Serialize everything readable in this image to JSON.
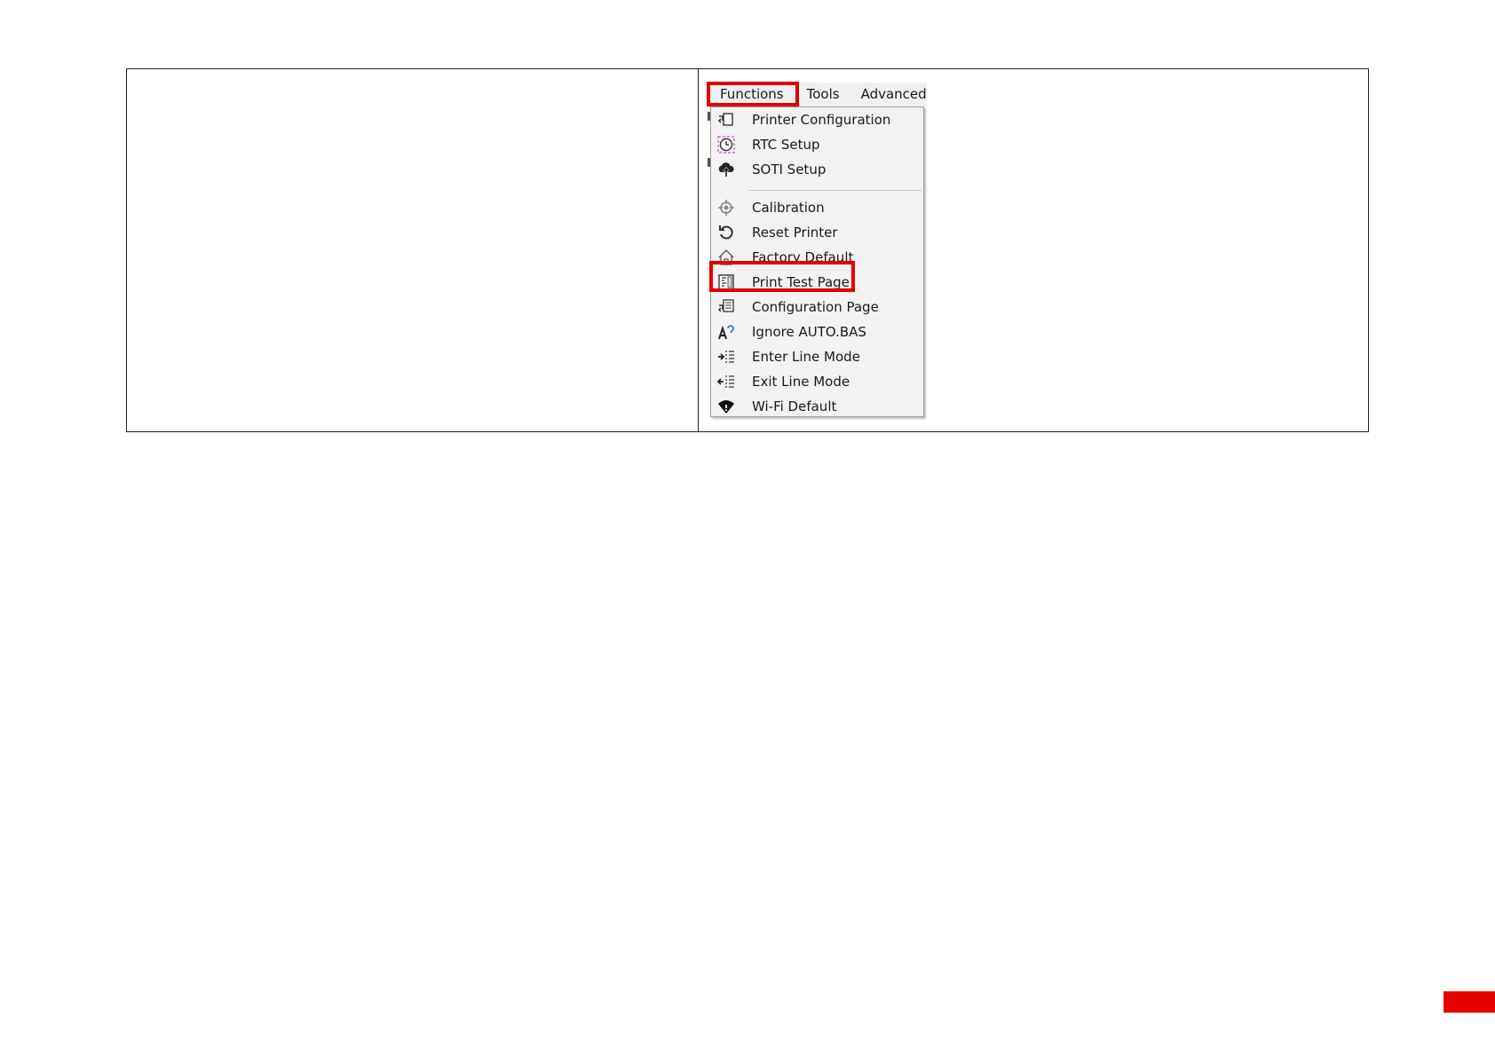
{
  "menubar": {
    "items": [
      {
        "label": "Functions",
        "name": "menu-functions"
      },
      {
        "label": "Tools",
        "name": "menu-tools"
      },
      {
        "label": "Advanced",
        "name": "menu-advanced"
      }
    ]
  },
  "dropdown": {
    "items": [
      {
        "label": "Printer Configuration",
        "icon": "printer-config-icon"
      },
      {
        "label": "RTC Setup",
        "icon": "clock-icon"
      },
      {
        "label": "SOTI Setup",
        "icon": "cloud-upload-icon"
      },
      {
        "label": "Calibration",
        "icon": "crosshair-icon"
      },
      {
        "label": "Reset Printer",
        "icon": "reset-arrow-icon"
      },
      {
        "label": "Factory Default",
        "icon": "home-icon"
      },
      {
        "label": "Print Test Page",
        "icon": "test-page-icon"
      },
      {
        "label": "Configuration Page",
        "icon": "config-page-icon"
      },
      {
        "label": "Ignore AUTO.BAS",
        "icon": "ignore-autobas-icon"
      },
      {
        "label": "Enter Line Mode",
        "icon": "enter-line-mode-icon"
      },
      {
        "label": "Exit Line Mode",
        "icon": "exit-line-mode-icon"
      },
      {
        "label": "Wi-Fi Default",
        "icon": "wifi-icon"
      }
    ]
  },
  "highlight_color": "#e00000",
  "page_tab_color": "#e60000"
}
